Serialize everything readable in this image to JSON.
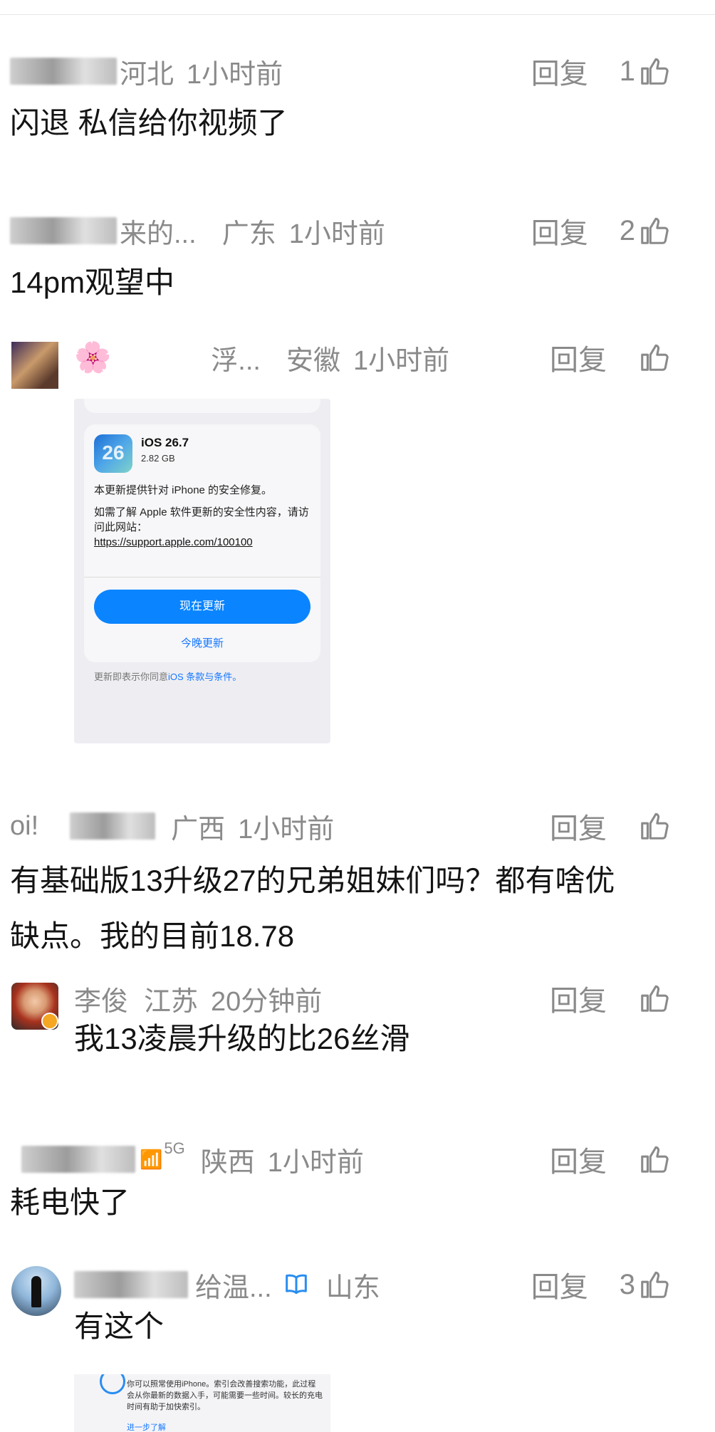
{
  "comments": [
    {
      "user": "河北",
      "region": "",
      "time": "1小时前",
      "reply": "回复",
      "likes": "1",
      "text": "闪退 私信给你视频了"
    },
    {
      "user": "来的...",
      "region": "广东",
      "time": "1小时前",
      "reply": "回复",
      "likes": "2",
      "text": "14pm观望中"
    },
    {
      "user": "🌸",
      "user2": "浮...",
      "region": "安徽",
      "time": "1小时前",
      "reply": "回复",
      "likes": "",
      "image": {
        "app_title": "iOS 26.7",
        "icon_text": "26",
        "size": "2.82 GB",
        "desc1": "本更新提供针对 iPhone 的安全修复。",
        "desc2": "如需了解 Apple 软件更新的安全性内容，请访问此网站：",
        "link": "https://support.apple.com/100100",
        "update_now": "现在更新",
        "update_tonight": "今晚更新",
        "terms_prefix": "更新即表示你同意",
        "terms_link": "iOS 条款与条件。"
      }
    },
    {
      "user": "oi!",
      "region": "广西",
      "time": "1小时前",
      "reply": "回复",
      "likes": "",
      "text_line1": "有基础版13升级27的兄弟姐妹们吗？都有啥优",
      "text_line2": "缺点。我的目前18.78"
    },
    {
      "user": "李俊",
      "region": "江苏",
      "time": "20分钟前",
      "reply": "回复",
      "likes": "",
      "text": "我13凌晨升级的比26丝滑"
    },
    {
      "user": "5G",
      "region": "陕西",
      "time": "1小时前",
      "reply": "回复",
      "likes": "",
      "text": "耗电快了"
    },
    {
      "user": "给温...",
      "region": "山东",
      "time": "",
      "reply": "回复",
      "likes": "3",
      "text": "有这个",
      "image": {
        "text": "你可以照常使用iPhone。索引会改善搜索功能，此过程会从你最新的数据入手，可能需要一些时间。较长的充电时间有助于加快索引。",
        "more": "进一步了解"
      }
    }
  ],
  "colors": {
    "meta": "#8a8a8a",
    "text": "#141414",
    "link": "#1677ff",
    "button": "#0a84ff"
  }
}
